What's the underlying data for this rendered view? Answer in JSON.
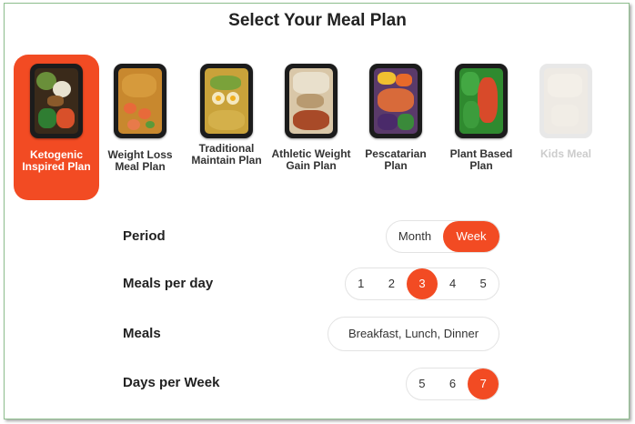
{
  "title": "Select Your Meal Plan",
  "accent": "#f24b23",
  "plans": [
    {
      "label": "Ketogenic Inspired Plan",
      "icon": "keto-meal-tray-icon",
      "active": true
    },
    {
      "label": "Weight Loss Meal Plan",
      "icon": "shrimp-rice-tray-icon"
    },
    {
      "label": "Traditional Maintain Plan",
      "icon": "egg-rice-tray-icon"
    },
    {
      "label": "Athletic Weight Gain Plan",
      "icon": "chicken-beans-tray-icon"
    },
    {
      "label": "Pescatarian Plan",
      "icon": "fish-veggie-tray-icon"
    },
    {
      "label": "Plant Based Plan",
      "icon": "salad-tray-icon"
    },
    {
      "label": "Kids Meal",
      "icon": "kids-meal-tray-icon",
      "disabled": true
    }
  ],
  "period": {
    "label": "Period",
    "options": [
      "Month",
      "Week"
    ],
    "selected": "Week"
  },
  "meals_per_day": {
    "label": "Meals per day",
    "options": [
      "1",
      "2",
      "3",
      "4",
      "5"
    ],
    "selected": "3"
  },
  "meals": {
    "label": "Meals",
    "value": "Breakfast, Lunch, Dinner"
  },
  "days_per_week": {
    "label": "Days per Week",
    "options": [
      "5",
      "6",
      "7"
    ],
    "selected": "7"
  }
}
